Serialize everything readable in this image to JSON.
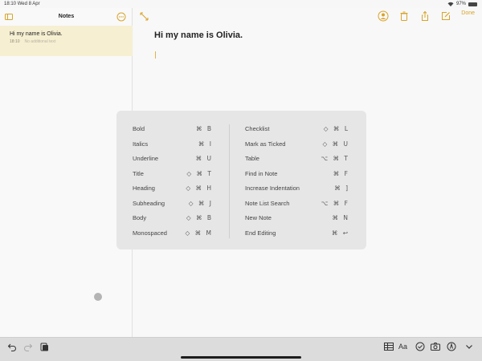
{
  "status": {
    "time": "18:10",
    "date": "Wed 8 Apr",
    "battery": "97%",
    "battery_level": 0.97
  },
  "sidebar": {
    "title": "Notes",
    "notes": [
      {
        "title": "Hi my name is Olivia.",
        "time": "18:10",
        "subtitle": "No additional text"
      }
    ]
  },
  "editor": {
    "heading": "Hi my name is Olivia.",
    "done_label": "Done"
  },
  "shortcuts": {
    "left": [
      {
        "label": "Bold",
        "keys": "⌘ B"
      },
      {
        "label": "Italics",
        "keys": "⌘ I"
      },
      {
        "label": "Underline",
        "keys": "⌘ U"
      },
      {
        "label": "Title",
        "keys": "◇ ⌘ T"
      },
      {
        "label": "Heading",
        "keys": "◇ ⌘ H"
      },
      {
        "label": "Subheading",
        "keys": "◇ ⌘ J"
      },
      {
        "label": "Body",
        "keys": "◇ ⌘ B"
      },
      {
        "label": "Monospaced",
        "keys": "◇ ⌘ M"
      }
    ],
    "right": [
      {
        "label": "Checklist",
        "keys": "◇ ⌘ L"
      },
      {
        "label": "Mark as Ticked",
        "keys": "◇ ⌘ U"
      },
      {
        "label": "Table",
        "keys": "⌥ ⌘ T"
      },
      {
        "label": "Find in Note",
        "keys": "⌘ F"
      },
      {
        "label": "Increase Indentation",
        "keys": "⌘ ]"
      },
      {
        "label": "Note List Search",
        "keys": "⌥ ⌘ F"
      },
      {
        "label": "New Note",
        "keys": "⌘ N"
      },
      {
        "label": "End Editing",
        "keys": "⌘ ↩"
      }
    ]
  },
  "bottom_toolbar": {
    "format_label": "Aa"
  },
  "colors": {
    "accent": "#d9a32a",
    "selected_note_bg": "#f6efd2",
    "panel_bg": "#e6e6e6"
  },
  "icons": [
    "sidebar-toggle-icon",
    "more-icon",
    "expand-icon",
    "share-person-icon",
    "trash-icon",
    "share-icon",
    "compose-icon",
    "undo-icon",
    "redo-icon",
    "paste-icon",
    "table-icon",
    "checklist-icon",
    "camera-icon",
    "markup-icon",
    "chevron-down-icon"
  ]
}
